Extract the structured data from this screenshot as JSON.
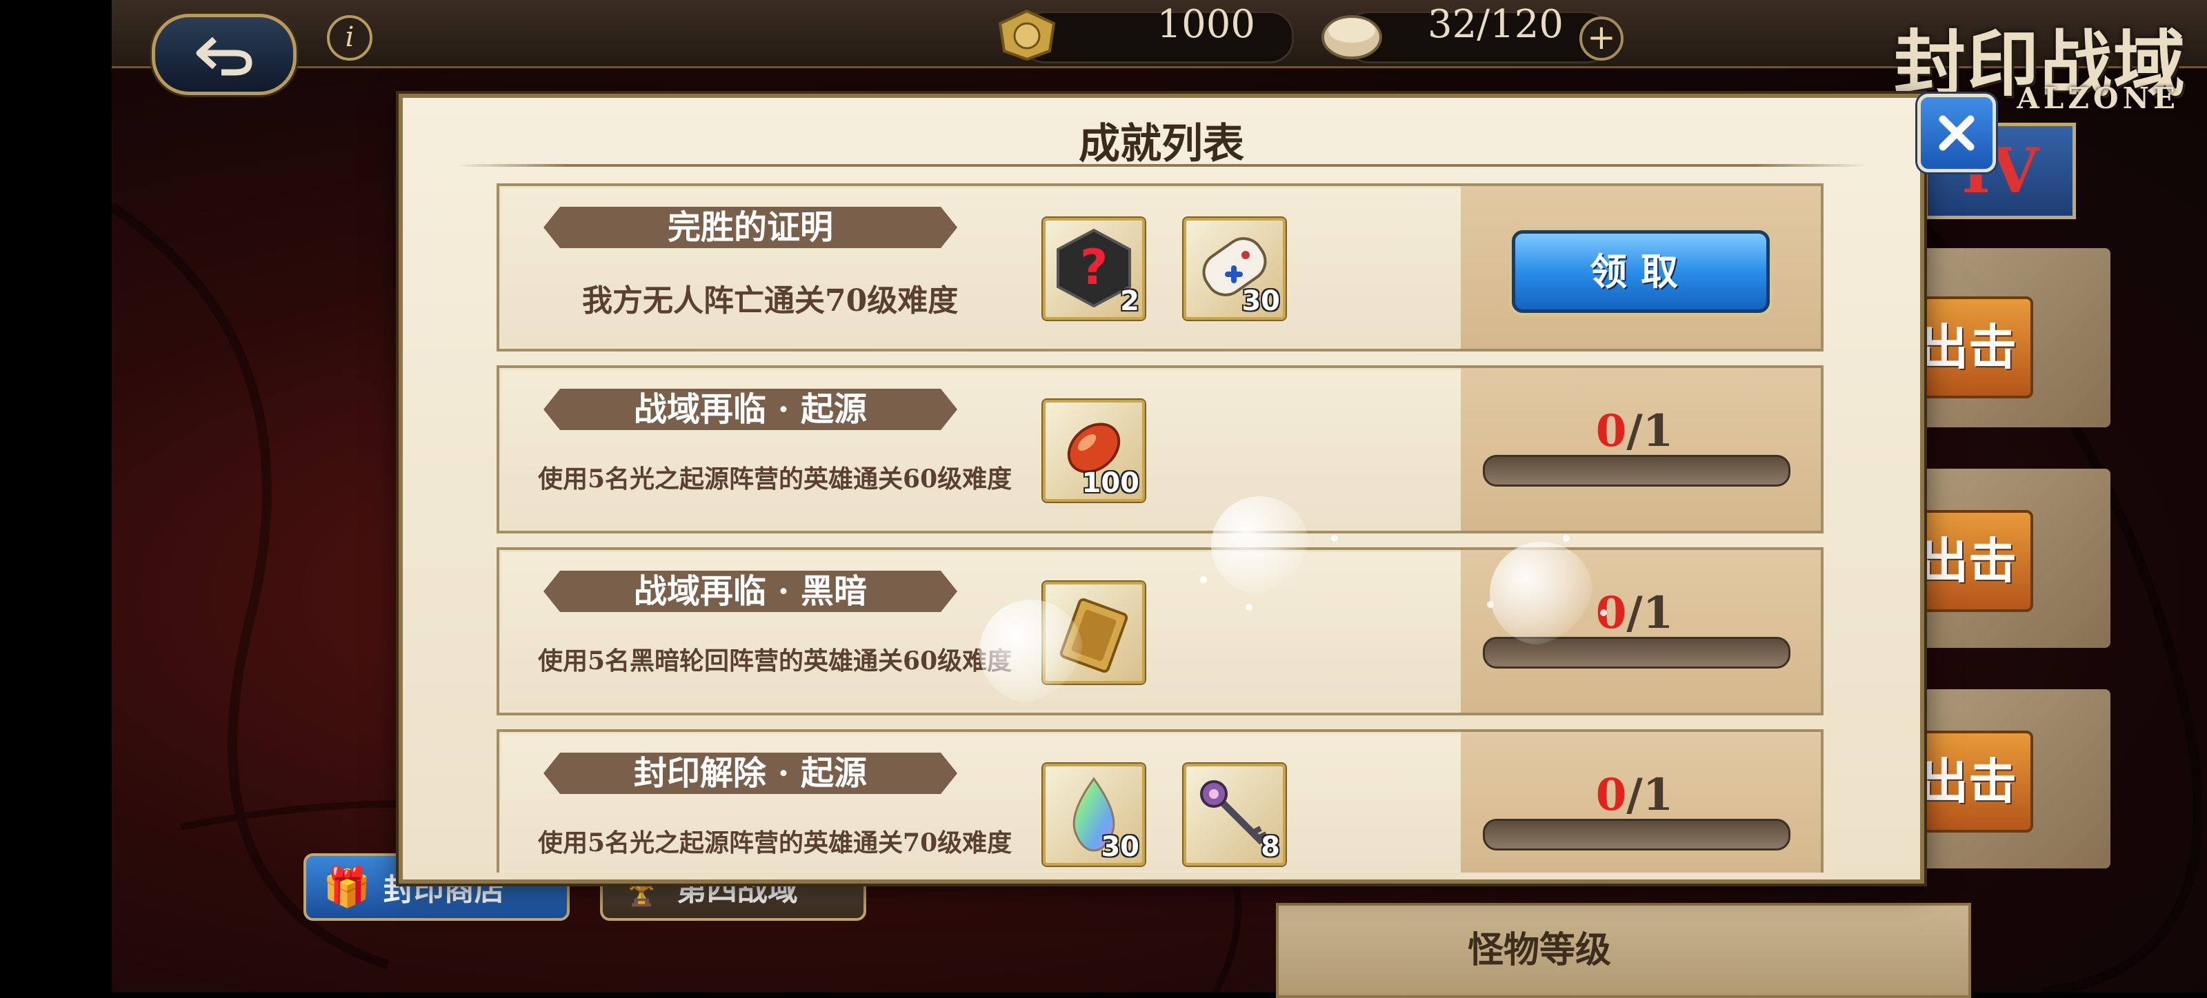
{
  "top_bar": {
    "coins": "1000",
    "stamina": "32/120"
  },
  "logo": {
    "title": "封印战域",
    "subtitle": "ALZONE"
  },
  "background": {
    "side_roman": "IV",
    "side_button_label": "出击",
    "shop_button": "封印商店",
    "zone_button": "第四战域",
    "monster_level_label": "怪物等级"
  },
  "modal": {
    "title": "成就列表",
    "achievements": [
      {
        "title": "完胜的证明",
        "description": "我方无人阵亡通关70级难度",
        "rewards": [
          {
            "icon": "mystery-box-icon",
            "count": "2"
          },
          {
            "icon": "game-controller-icon",
            "count": "30"
          }
        ],
        "status": "claimable",
        "claim_label": "领取"
      },
      {
        "title": "战域再临 · 起源",
        "description": "使用5名光之起源阵营的英雄通关60级难度",
        "rewards": [
          {
            "icon": "red-seed-icon",
            "count": "100"
          }
        ],
        "status": "in-progress",
        "progress_current": "0",
        "progress_total": "/1",
        "progress_fraction": 0
      },
      {
        "title": "战域再临 · 黑暗",
        "description": "使用5名黑暗轮回阵营的英雄通关60级难度",
        "rewards": [
          {
            "icon": "card-ticket-icon",
            "count": ""
          }
        ],
        "status": "in-progress",
        "progress_current": "0",
        "progress_total": "/1",
        "progress_fraction": 0
      },
      {
        "title": "封印解除 · 起源",
        "description": "使用5名光之起源阵营的英雄通关70级难度",
        "rewards": [
          {
            "icon": "rainbow-crystal-icon",
            "count": "30"
          },
          {
            "icon": "ornate-key-icon",
            "count": "8"
          }
        ],
        "status": "in-progress",
        "progress_current": "0",
        "progress_total": "/1",
        "progress_fraction": 0
      }
    ]
  }
}
